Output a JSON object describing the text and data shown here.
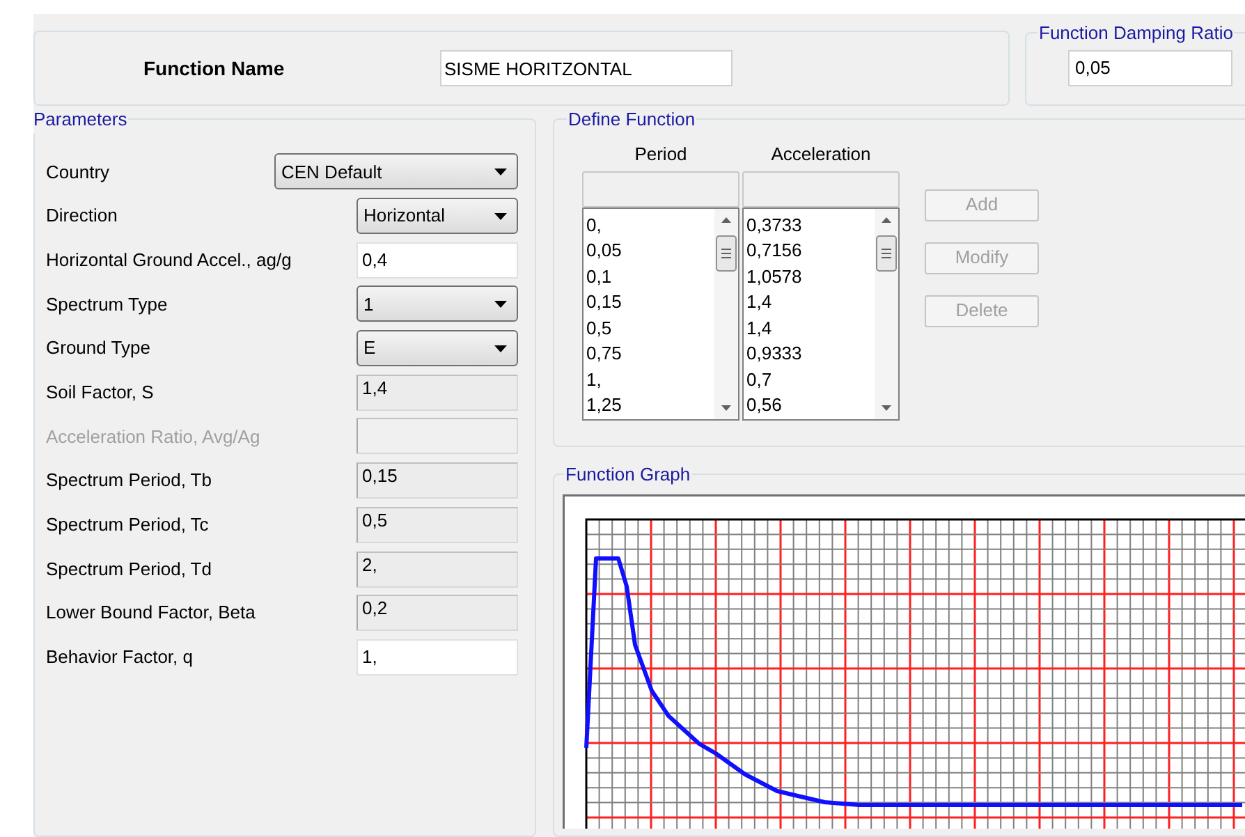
{
  "function_name": {
    "label": "Function Name",
    "value": "SISME HORITZONTAL"
  },
  "damping": {
    "title": "Function Damping Ratio",
    "value": "0,05"
  },
  "parameters": {
    "title": "Parameters",
    "rows": [
      {
        "label": "Country",
        "kind": "dropdown",
        "value": "CEN Default",
        "wide": true,
        "disabled": false
      },
      {
        "label": "Direction",
        "kind": "dropdown",
        "value": "Horizontal",
        "wide": false,
        "disabled": false
      },
      {
        "label": "Horizontal Ground Accel.,  ag/g",
        "kind": "input",
        "value": "0,4",
        "wide": false,
        "disabled": false
      },
      {
        "label": "Spectrum Type",
        "kind": "dropdown",
        "value": "1",
        "wide": false,
        "disabled": false
      },
      {
        "label": "Ground Type",
        "kind": "dropdown",
        "value": "E",
        "wide": false,
        "disabled": false
      },
      {
        "label": "Soil Factor, S",
        "kind": "readonly",
        "value": "1,4",
        "wide": false,
        "disabled": false
      },
      {
        "label": "Acceleration Ratio,  Avg/Ag",
        "kind": "readonly",
        "wide": false,
        "disabled": true
      },
      {
        "label": "Spectrum Period, Tb",
        "kind": "readonly",
        "value": "0,15",
        "wide": false,
        "disabled": false
      },
      {
        "label": "Spectrum Period, Tc",
        "kind": "readonly",
        "value": "0,5",
        "wide": false,
        "disabled": false
      },
      {
        "label": "Spectrum Period, Td",
        "kind": "readonly",
        "value": "2,",
        "wide": false,
        "disabled": false
      },
      {
        "label": "Lower Bound Factor, Beta",
        "kind": "readonly",
        "value": "0,2",
        "wide": false,
        "disabled": false
      },
      {
        "label": "Behavior Factor, q",
        "kind": "input",
        "value": "1,",
        "wide": false,
        "disabled": false
      }
    ]
  },
  "define_function": {
    "title": "Define Function",
    "columns": [
      {
        "header": "Period",
        "values": [
          "0,",
          "0,05",
          "0,1",
          "0,15",
          "0,5",
          "0,75",
          "1,",
          "1,25"
        ]
      },
      {
        "header": "Acceleration",
        "values": [
          "0,3733",
          "0,7156",
          "1,0578",
          "1,4",
          "1,4",
          "0,9333",
          "0,7",
          "0,56"
        ]
      }
    ],
    "buttons": [
      {
        "label": "Add",
        "disabled": true
      },
      {
        "label": "Modify",
        "disabled": true
      },
      {
        "label": "Delete",
        "disabled": true
      }
    ]
  },
  "graph": {
    "title": "Function Graph"
  }
}
